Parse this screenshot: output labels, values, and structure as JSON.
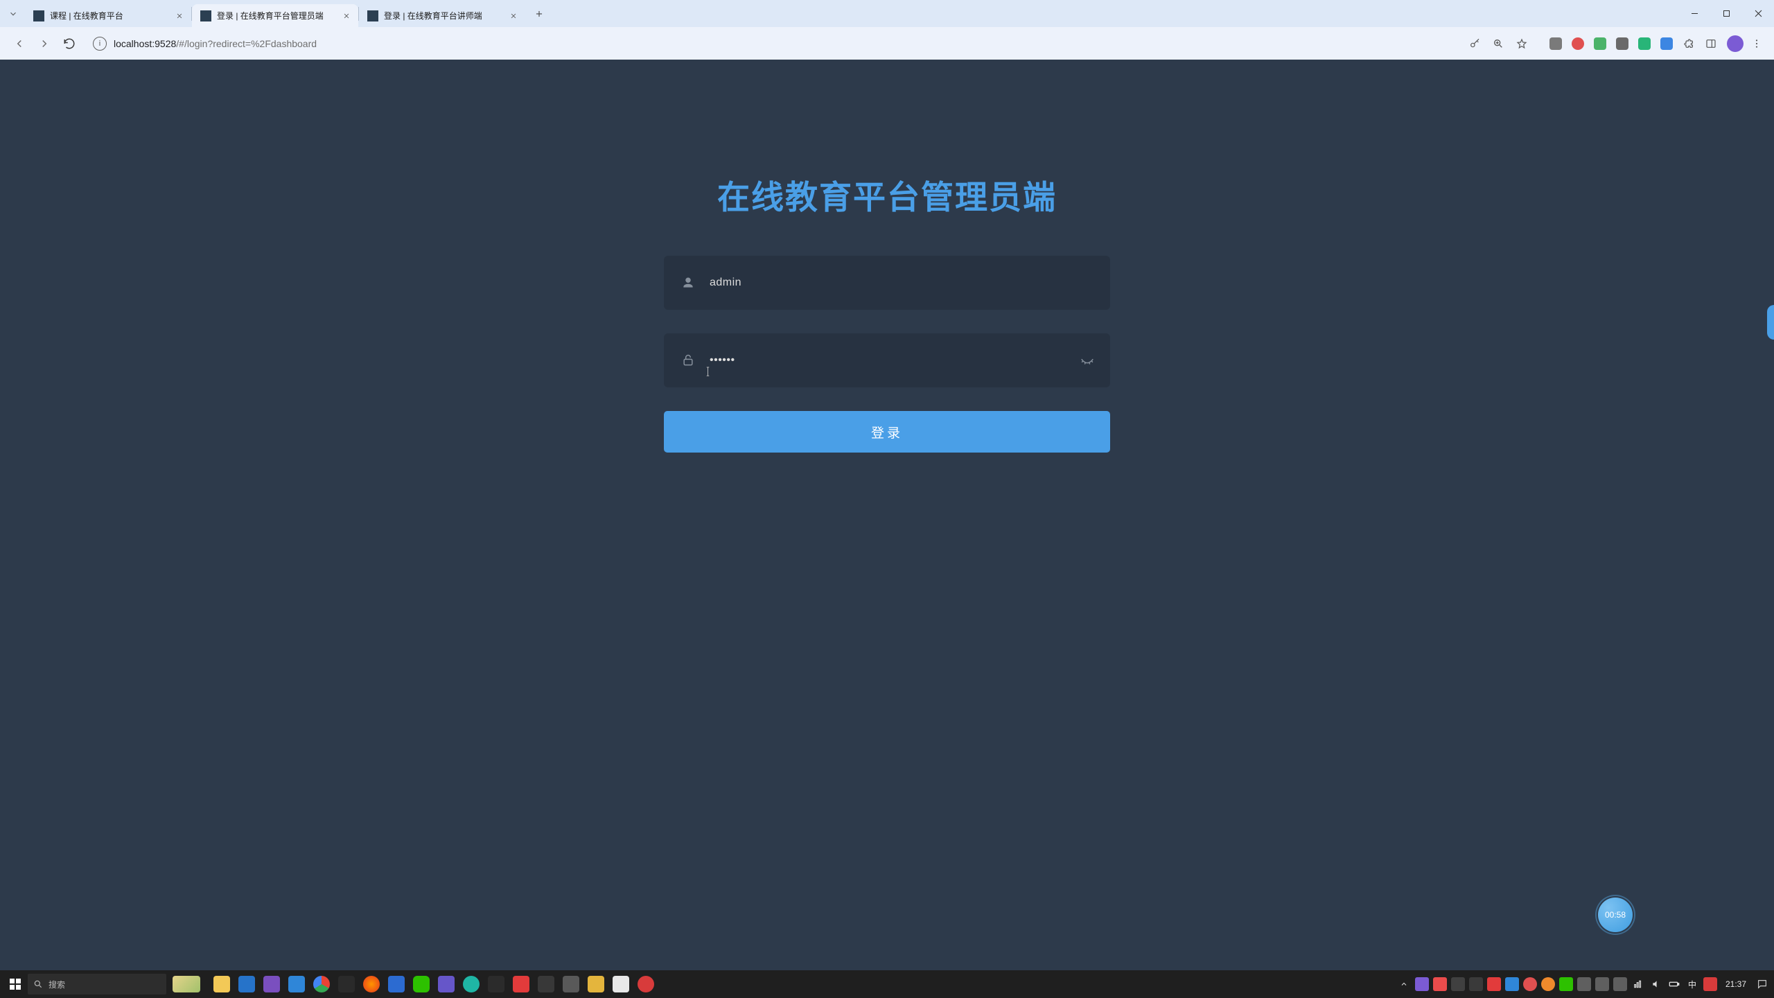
{
  "browser": {
    "tabs": [
      {
        "title": "课程 | 在线教育平台",
        "active": false
      },
      {
        "title": "登录 | 在线教育平台管理员端",
        "active": true
      },
      {
        "title": "登录 | 在线教育平台讲师端",
        "active": false
      }
    ],
    "url_host": "localhost:9528",
    "url_path": "/#/login?redirect=%2Fdashboard"
  },
  "login": {
    "title": "在线教育平台管理员端",
    "username_value": "admin",
    "password_value": "••••••",
    "login_button_label": "登录"
  },
  "floating_timer": "00:58",
  "taskbar": {
    "search_placeholder": "搜索",
    "ime": "中",
    "clock": "21:37"
  }
}
